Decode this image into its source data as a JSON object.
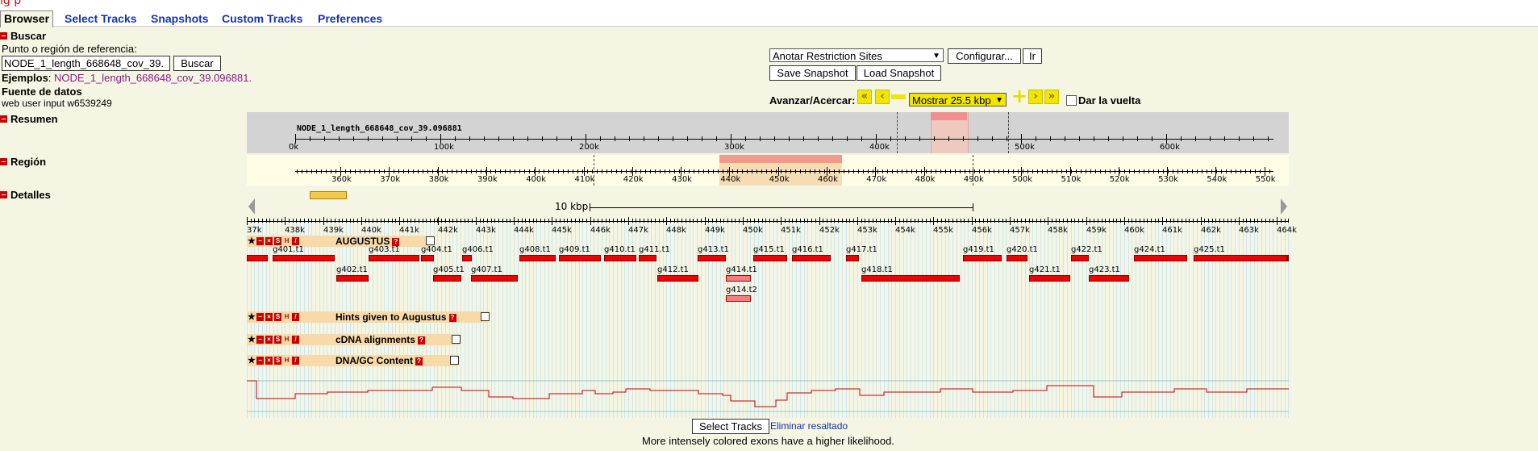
{
  "top": {
    "red_text": "ig p"
  },
  "tabs": [
    {
      "label": "Browser",
      "active": true
    },
    {
      "label": "Select Tracks"
    },
    {
      "label": "Snapshots"
    },
    {
      "label": "Custom Tracks"
    },
    {
      "label": "Preferences"
    }
  ],
  "search": {
    "section_title": "Buscar",
    "landmark_label": "Punto o región de referencia",
    "landmark_value": "NODE_1_length_668648_cov_39.",
    "search_button": "Buscar",
    "examples_label": "Ejemplos",
    "examples_value": "NODE_1_length_668648_cov_39.096881.",
    "source_label": "Fuente de datos",
    "source_value": "web user input w6539249"
  },
  "controls": {
    "annotate_select": "Anotar Restriction Sites",
    "configure_button": "Configurar...",
    "go_button": "Ir",
    "save_snapshot": "Save Snapshot",
    "load_snapshot": "Load Snapshot",
    "scroll_label": "Avanzar/Acercar:",
    "zoom_select": "Mostrar 25.5 kbp",
    "flip_label": "Dar la vuelta"
  },
  "sections": {
    "overview": "Resumen",
    "region": "Región",
    "details": "Detalles"
  },
  "overview": {
    "contig": "NODE_1_length_668648_cov_39.096881",
    "ticks": [
      "0k",
      "100k",
      "200k",
      "300k",
      "400k",
      "500k",
      "600k"
    ]
  },
  "region": {
    "ticks": [
      "360k",
      "370k",
      "380k",
      "390k",
      "400k",
      "410k",
      "420k",
      "430k",
      "440k",
      "450k",
      "460k",
      "470k",
      "480k",
      "490k",
      "500k",
      "510k",
      "520k",
      "530k",
      "540k",
      "550k"
    ]
  },
  "details": {
    "scale_label": "10 kbp",
    "ticks": [
      "37k",
      "438k",
      "439k",
      "440k",
      "441k",
      "442k",
      "443k",
      "444k",
      "445k",
      "446k",
      "447k",
      "448k",
      "449k",
      "450k",
      "451k",
      "452k",
      "453k",
      "454k",
      "455k",
      "456k",
      "457k",
      "458k",
      "459k",
      "460k",
      "461k",
      "462k",
      "463k",
      "464k"
    ],
    "tracks": {
      "augustus": "AUGUSTUS",
      "hints": "Hints given to Augustus",
      "cdna": "cDNA alignments",
      "gc": "DNA/GC Content"
    },
    "genes": [
      {
        "name": "g401.t1",
        "row": 0
      },
      {
        "name": "g403.t1",
        "row": 0
      },
      {
        "name": "g404.t1",
        "row": 0
      },
      {
        "name": "g406.t1",
        "row": 0
      },
      {
        "name": "g408.t1",
        "row": 0
      },
      {
        "name": "g409.t1",
        "row": 0
      },
      {
        "name": "g410.t1",
        "row": 0
      },
      {
        "name": "g411.t1",
        "row": 0
      },
      {
        "name": "g413.t1",
        "row": 0
      },
      {
        "name": "g415.t1",
        "row": 0
      },
      {
        "name": "g416.t1",
        "row": 0
      },
      {
        "name": "g417.t1",
        "row": 0
      },
      {
        "name": "g419.t1",
        "row": 0
      },
      {
        "name": "g420.t1",
        "row": 0
      },
      {
        "name": "g422.t1",
        "row": 0
      },
      {
        "name": "g424.t1",
        "row": 0
      },
      {
        "name": "g425.t1",
        "row": 0
      },
      {
        "name": "g402.t1",
        "row": 1
      },
      {
        "name": "g405.t1",
        "row": 1
      },
      {
        "name": "g407.t1",
        "row": 1
      },
      {
        "name": "g412.t1",
        "row": 1
      },
      {
        "name": "g414.t1",
        "row": 1
      },
      {
        "name": "g418.t1",
        "row": 1
      },
      {
        "name": "g421.t1",
        "row": 1
      },
      {
        "name": "g423.t1",
        "row": 1
      },
      {
        "name": "g414.t2",
        "row": 2
      }
    ]
  },
  "footer": {
    "select_tracks_button": "Select Tracks",
    "clear_highlight": "Eliminar resaltado",
    "note": "More intensely colored exons have a higher likelihood."
  }
}
